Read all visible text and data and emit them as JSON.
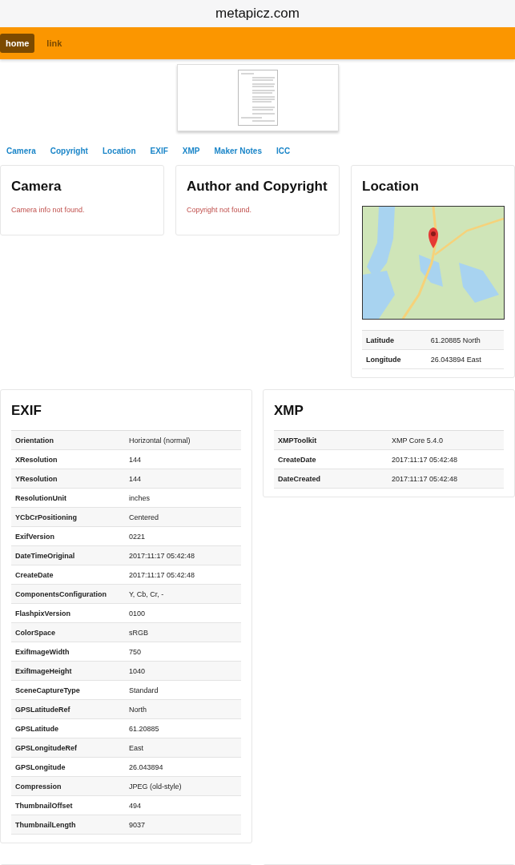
{
  "address_bar": {
    "url": "metapicz.com"
  },
  "navbar": {
    "items": [
      {
        "label": "home",
        "selected": true
      },
      {
        "label": "link",
        "selected": false
      }
    ]
  },
  "section_links": [
    "Camera",
    "Copyright",
    "Location",
    "EXIF",
    "XMP",
    "Maker Notes",
    "ICC"
  ],
  "cards_top": [
    {
      "kind": "message",
      "title": "Camera",
      "message": "Camera info not found."
    },
    {
      "kind": "message",
      "title": "Author and Copyright",
      "message": "Copyright not found."
    },
    {
      "kind": "map",
      "title": "Location",
      "rows": [
        {
          "key": "Latitude",
          "value": "61.20885 North"
        },
        {
          "key": "Longitude",
          "value": "26.043894 East"
        }
      ]
    }
  ],
  "exif": {
    "title": "EXIF",
    "rows": [
      {
        "key": "Orientation",
        "value": "Horizontal (normal)"
      },
      {
        "key": "XResolution",
        "value": "144"
      },
      {
        "key": "YResolution",
        "value": "144"
      },
      {
        "key": "ResolutionUnit",
        "value": "inches"
      },
      {
        "key": "YCbCrPositioning",
        "value": "Centered"
      },
      {
        "key": "ExifVersion",
        "value": "0221"
      },
      {
        "key": "DateTimeOriginal",
        "value": "2017:11:17 05:42:48"
      },
      {
        "key": "CreateDate",
        "value": "2017:11:17 05:42:48"
      },
      {
        "key": "ComponentsConfiguration",
        "value": "Y, Cb, Cr, -"
      },
      {
        "key": "FlashpixVersion",
        "value": "0100"
      },
      {
        "key": "ColorSpace",
        "value": "sRGB"
      },
      {
        "key": "ExifImageWidth",
        "value": "750"
      },
      {
        "key": "ExifImageHeight",
        "value": "1040"
      },
      {
        "key": "SceneCaptureType",
        "value": "Standard"
      },
      {
        "key": "GPSLatitudeRef",
        "value": "North"
      },
      {
        "key": "GPSLatitude",
        "value": "61.20885"
      },
      {
        "key": "GPSLongitudeRef",
        "value": "East"
      },
      {
        "key": "GPSLongitude",
        "value": "26.043894"
      },
      {
        "key": "Compression",
        "value": "JPEG (old-style)"
      },
      {
        "key": "ThumbnailOffset",
        "value": "494"
      },
      {
        "key": "ThumbnailLength",
        "value": "9037"
      }
    ]
  },
  "xmp": {
    "title": "XMP",
    "rows": [
      {
        "key": "XMPToolkit",
        "value": "XMP Core 5.4.0"
      },
      {
        "key": "CreateDate",
        "value": "2017:11:17 05:42:48"
      },
      {
        "key": "DateCreated",
        "value": "2017:11:17 05:42:48"
      }
    ]
  }
}
